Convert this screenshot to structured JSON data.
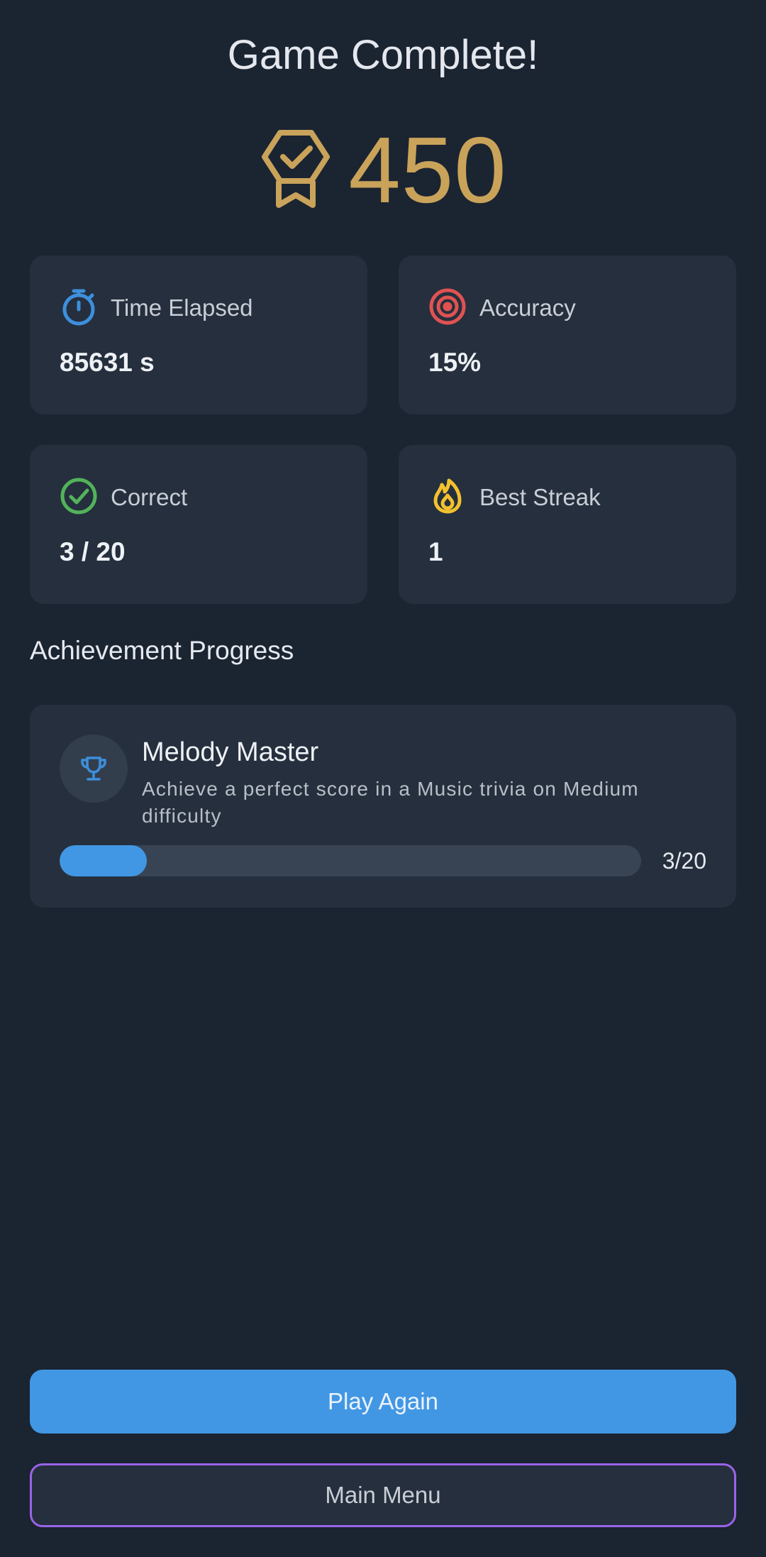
{
  "title": "Game Complete!",
  "score": {
    "value": "450",
    "icon": "award-badge-icon",
    "color": "#c9a35a"
  },
  "stats": [
    {
      "icon": "stopwatch-icon",
      "icon_color": "#3d8fdc",
      "label": "Time Elapsed",
      "value": "85631 s"
    },
    {
      "icon": "target-icon",
      "icon_color": "#e05252",
      "label": "Accuracy",
      "value": "15%"
    },
    {
      "icon": "check-circle-icon",
      "icon_color": "#52b35a",
      "label": "Correct",
      "value": "3 / 20"
    },
    {
      "icon": "flame-icon",
      "icon_color": "#f2c12e",
      "label": "Best Streak",
      "value": "1"
    }
  ],
  "achievements": {
    "section_title": "Achievement Progress",
    "items": [
      {
        "icon": "trophy-icon",
        "name": "Melody Master",
        "description": "Achieve a perfect score in a Music trivia on Medium difficulty",
        "progress_text": "3/20",
        "progress_fraction": 0.15
      }
    ]
  },
  "buttons": {
    "play_again": "Play Again",
    "main_menu": "Main Menu"
  },
  "colors": {
    "background": "#1b2431",
    "card": "#252f3d",
    "accent_blue": "#4197e4",
    "accent_purple": "#9a63e8",
    "gold": "#c9a35a"
  }
}
